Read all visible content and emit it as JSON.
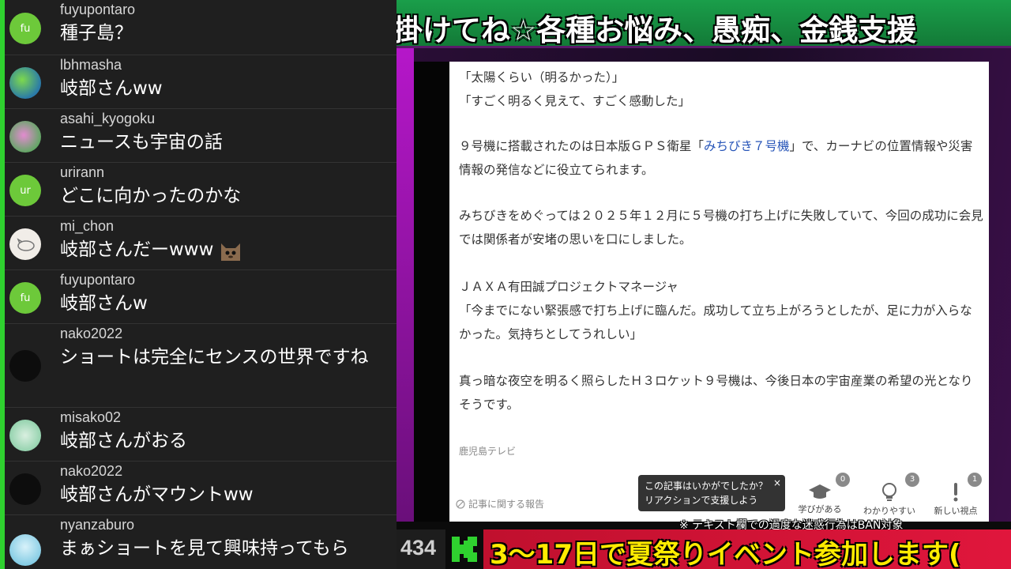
{
  "chat": {
    "messages": [
      {
        "user": "fuyupontaro",
        "text": "種子島？",
        "avatar": "fu",
        "avatar_color": "#6dc93a"
      },
      {
        "user": "lbhmasha",
        "text": "岐部さんww",
        "avatar": "",
        "avatar_color": "#4aa0c8"
      },
      {
        "user": "asahi_kyogoku",
        "text": "ニュースも宇宙の話",
        "avatar": "",
        "avatar_color": "#c96ab5"
      },
      {
        "user": "urirann",
        "text": "どこに向かったのかな",
        "avatar": "ur",
        "avatar_color": "#6dc93a"
      },
      {
        "user": "mi_chon",
        "text": "岐部さんだーwww",
        "avatar": "",
        "avatar_color": "#f1ede8"
      },
      {
        "user": "fuyupontaro",
        "text": "岐部さんw",
        "avatar": "fu",
        "avatar_color": "#6dc93a"
      },
      {
        "user": "nako2022",
        "text": "ショートは完全にセンスの世界ですね",
        "avatar": "",
        "avatar_color": "#0d0d0d"
      },
      {
        "user": "misako02",
        "text": "岐部さんがおる",
        "avatar": "",
        "avatar_color": "#a9d8b8"
      },
      {
        "user": "nako2022",
        "text": "岐部さんがマウントww",
        "avatar": "",
        "avatar_color": "#0d0d0d"
      },
      {
        "user": "nyanzaburo",
        "text": "まぁショートを見て興味持ってもら",
        "avatar": "",
        "avatar_color": "#8fd0e8"
      }
    ]
  },
  "ticker": {
    "text": "掛けてね☆各種お悩み、愚痴、金銭支援"
  },
  "article": {
    "p1": "「太陽くらい（明るかった）」",
    "p2": "「すごく明るく見えて、すごく感動した」",
    "p3a": "９号機に搭載されたのは日本版ＧＰＳ衛星「",
    "p3link": "みちびき７号機",
    "p3b": "」で、カーナビの位置情報や災害情報の発信などに役立てられます。",
    "p4": "みちびきをめぐっては２０２５年１２月に５号機の打ち上げに失敗していて、今回の成功に会見では関係者が安堵の思いを口にしました。",
    "p5": "ＪＡＸＡ有田誠プロジェクトマネージャ",
    "p6": "「今までにない緊張感で打ち上げに臨んだ。成功して立ち上がろうとしたが、足に力が入らなかった。気持ちとしてうれしい」",
    "p7": "真っ暗な夜空を明るく照らしたＨ３ロケット９号機は、今後日本の宇宙産業の希望の光となりそうです。",
    "source": "鹿児島テレビ",
    "report": "記事に関する報告",
    "feedback_line1": "この記事はいかがでしたか？",
    "feedback_line2": "リアクションで支援しよう",
    "feedback_close": "×",
    "reactions": [
      {
        "label": "学びがある",
        "count": "0"
      },
      {
        "label": "わかりやすい",
        "count": "3"
      },
      {
        "label": "新しい視点",
        "count": "1"
      }
    ]
  },
  "notice": "※ テキスト欄での過度な迷惑行為はBAN対象",
  "viewer_count": "434",
  "bottom_banner": "3～17日で夏祭りイベント参加します(​"
}
